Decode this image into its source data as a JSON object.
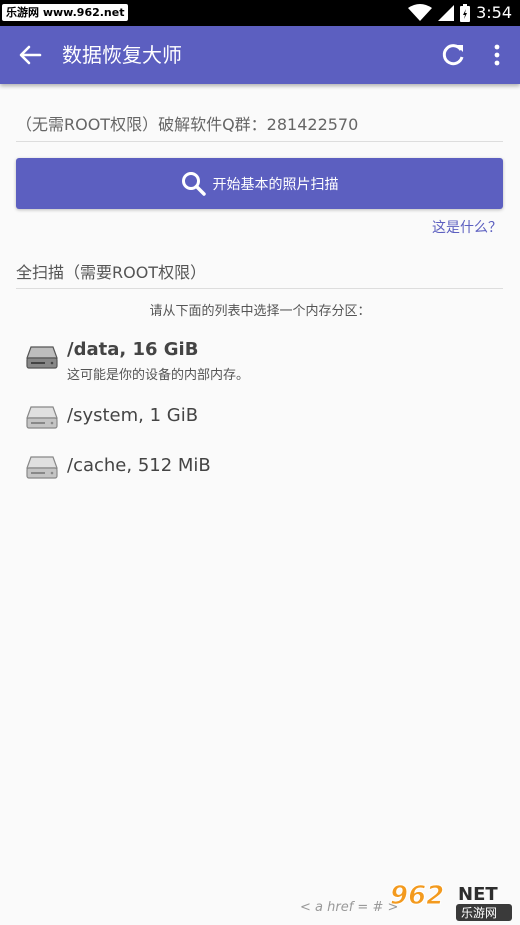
{
  "status_bar": {
    "site": "乐游网 www.962.net",
    "time": "3:54"
  },
  "app_bar": {
    "title": "数据恢复大师"
  },
  "basic_scan": {
    "root_note": "（无需ROOT权限）破解软件Q群：281422570",
    "button_label": "开始基本的照片扫描",
    "what_link": "这是什么？"
  },
  "full_scan": {
    "title": "全扫描（需要ROOT权限）",
    "prompt": "请从下面的列表中选择一个内存分区：",
    "partitions": [
      {
        "name": "/data, 16 GiB",
        "desc": "这可能是你的设备的内部内存。"
      },
      {
        "name": "/system, 1 GiB"
      },
      {
        "name": "/cache, 512 MiB"
      }
    ]
  },
  "watermark": {
    "text": "< a href = # >",
    "logo_main": "962",
    "logo_net": "NET",
    "logo_sub": "乐游网"
  },
  "colors": {
    "primary": "#5c5fc0",
    "status_bar": "#000000",
    "background": "#fafafa"
  }
}
